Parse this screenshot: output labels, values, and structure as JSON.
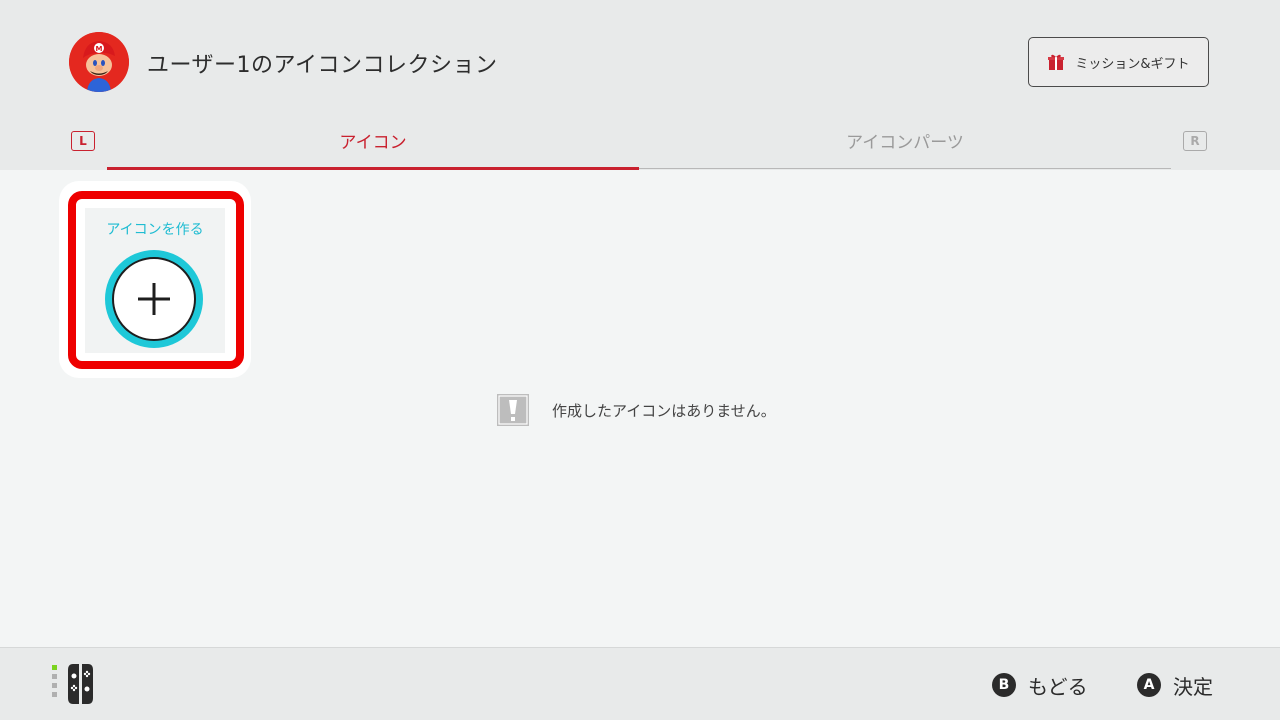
{
  "header": {
    "title": "ユーザー1のアイコンコレクション",
    "mission_button": "ミッション&ギフト"
  },
  "tabs": {
    "left_bumper": "L",
    "right_bumper": "R",
    "items": [
      {
        "label": "アイコン",
        "active": true
      },
      {
        "label": "アイコンパーツ",
        "active": false
      }
    ]
  },
  "main": {
    "create_card_label": "アイコンを作る",
    "empty_message": "作成したアイコンはありません。"
  },
  "footer": {
    "back": {
      "button": "B",
      "label": "もどる"
    },
    "confirm": {
      "button": "A",
      "label": "決定"
    }
  },
  "colors": {
    "accent": "#c9212f",
    "cyan": "#1ec8d8",
    "highlight": "#ee0000"
  },
  "icons": [
    "avatar-mario",
    "gift-icon",
    "plus-icon",
    "exclamation-icon",
    "joycon-icon"
  ]
}
